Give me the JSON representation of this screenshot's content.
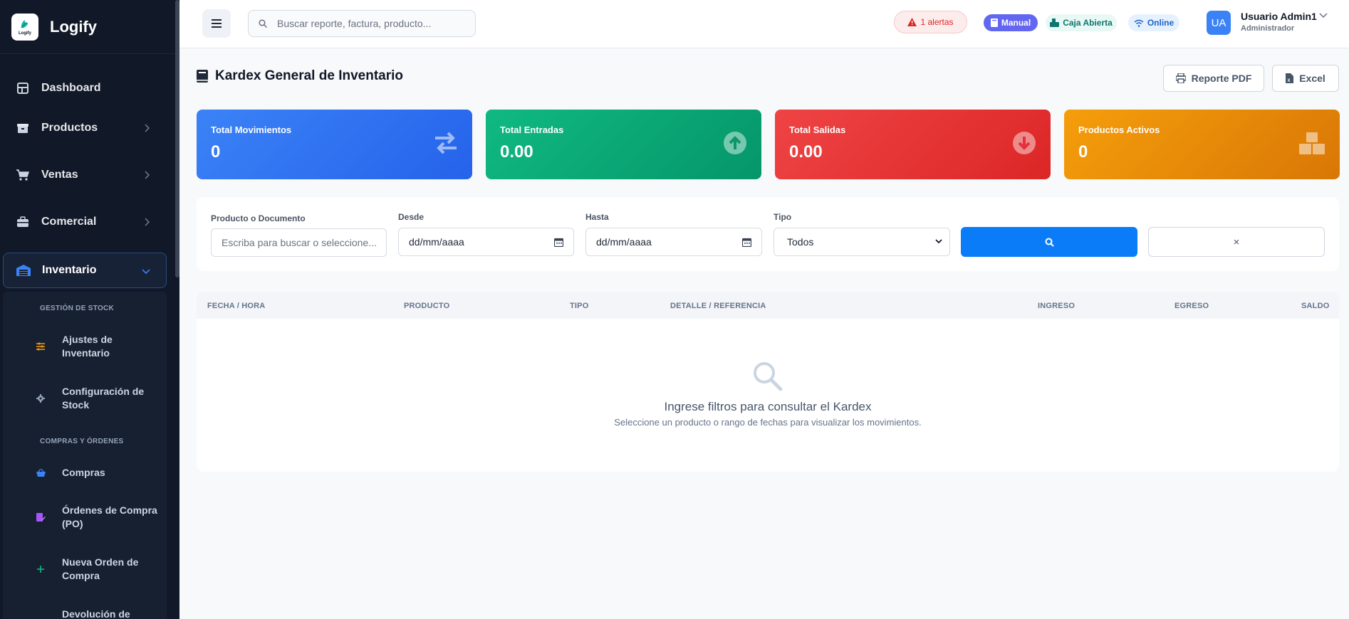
{
  "brand": {
    "name": "Logify",
    "logo_text": "Logify"
  },
  "sidebar": {
    "items": [
      {
        "label": "Dashboard",
        "icon": "dashboard-icon"
      },
      {
        "label": "Productos",
        "icon": "box-icon"
      },
      {
        "label": "Ventas",
        "icon": "cart-icon"
      },
      {
        "label": "Comercial",
        "icon": "briefcase-icon"
      },
      {
        "label": "Inventario",
        "icon": "warehouse-icon"
      }
    ],
    "submenu": {
      "section1": "GESTIÓN DE STOCK",
      "section2": "COMPRAS Y ÓRDENES",
      "items": [
        {
          "label": "Ajustes de Inventario",
          "icon": "sliders-icon",
          "color": "#f59e0b"
        },
        {
          "label": "Configuración de Stock",
          "icon": "gear-icon",
          "color": "#94a3b8"
        },
        {
          "label": "Compras",
          "icon": "basket-icon",
          "color": "#3b82f6"
        },
        {
          "label": "Órdenes de Compra (PO)",
          "icon": "file-edit-icon",
          "color": "#a855f7"
        },
        {
          "label": "Nueva Orden de Compra",
          "icon": "plus-icon",
          "color": "#10b981"
        },
        {
          "label": "Devolución de",
          "icon": "return-icon",
          "color": "#94a3b8"
        }
      ]
    }
  },
  "topbar": {
    "search_placeholder": "Buscar reporte, factura, producto...",
    "alerts": "1 alertas",
    "manual": "Manual",
    "caja": "Caja Abierta",
    "online": "Online",
    "avatar": "UA",
    "user_name": "Usuario Admin1",
    "user_role": "Administrador"
  },
  "page": {
    "title": "Kardex General de Inventario",
    "btn_pdf": "Reporte PDF",
    "btn_excel": "Excel"
  },
  "cards": [
    {
      "label": "Total Movimientos",
      "value": "0",
      "color": "#2f6bec",
      "icon": "swap-arrows-icon"
    },
    {
      "label": "Total Entradas",
      "value": "0.00",
      "color": "#10a36f",
      "icon": "arrow-up-circle-icon"
    },
    {
      "label": "Total Salidas",
      "value": "0.00",
      "color": "#e3303a",
      "icon": "arrow-down-circle-icon"
    },
    {
      "label": "Productos Activos",
      "value": "0",
      "color": "#ea8a0b",
      "icon": "boxes-icon"
    }
  ],
  "filters": {
    "producto_label": "Producto o Documento",
    "producto_placeholder": "Escriba para buscar o seleccione...",
    "desde_label": "Desde",
    "desde_value": "dd/mm/aaaa",
    "hasta_label": "Hasta",
    "hasta_value": "dd/mm/aaaa",
    "tipo_label": "Tipo",
    "tipo_value": "Todos",
    "clear": "×"
  },
  "table": {
    "columns": [
      "FECHA / HORA",
      "PRODUCTO",
      "TIPO",
      "DETALLE / REFERENCIA",
      "INGRESO",
      "EGRESO",
      "SALDO"
    ],
    "empty_title": "Ingrese filtros para consultar el Kardex",
    "empty_sub": "Seleccione un producto o rango de fechas para visualizar los movimientos."
  }
}
